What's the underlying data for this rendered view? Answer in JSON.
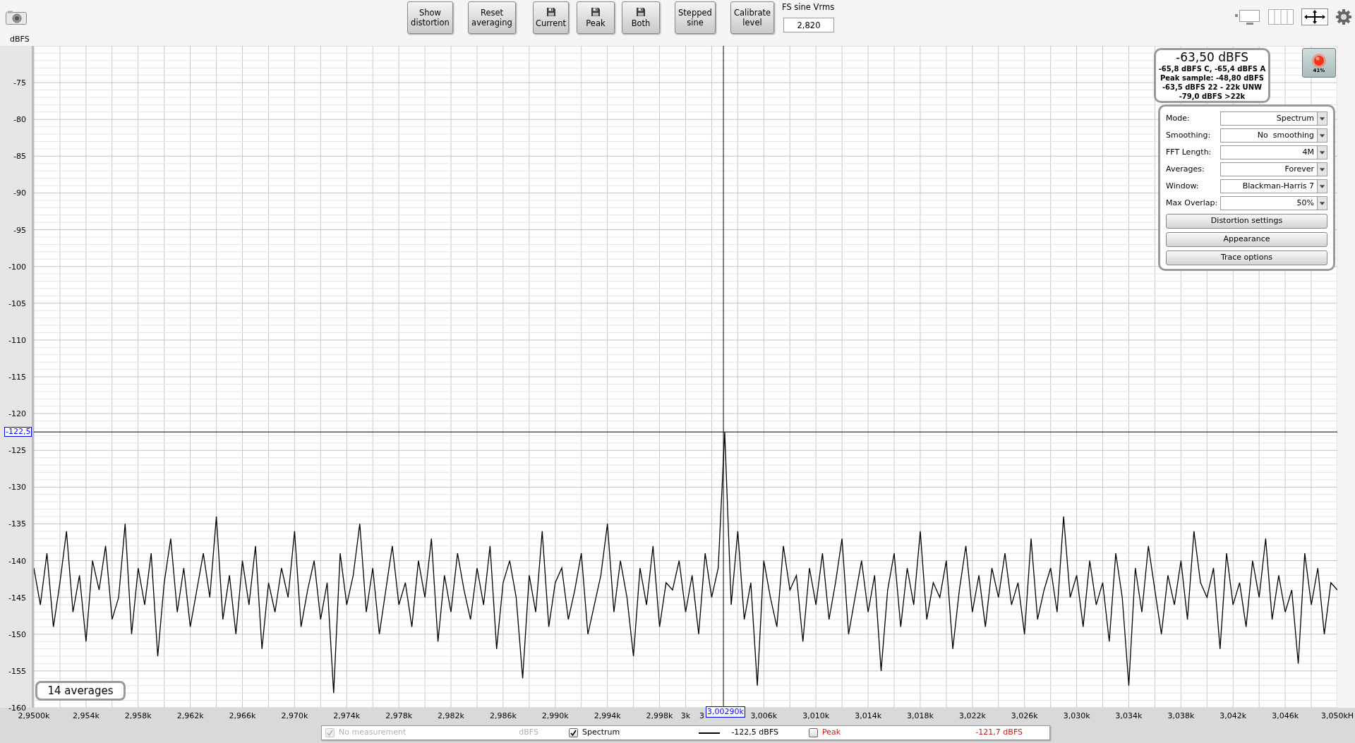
{
  "toolbar": {
    "buttons": [
      {
        "label": "Show\ndistortion",
        "kind": "text"
      },
      {
        "label": "Reset\naveraging",
        "kind": "text"
      },
      {
        "label": "Current",
        "kind": "save"
      },
      {
        "label": "Peak",
        "kind": "save"
      },
      {
        "label": "Both",
        "kind": "save"
      },
      {
        "label": "Stepped\nsine",
        "kind": "text"
      },
      {
        "label": "Calibrate\nlevel",
        "kind": "text"
      }
    ],
    "fs_field": {
      "label": "FS sine Vrms",
      "value": "2,820"
    }
  },
  "plot": {
    "chart_data": {
      "type": "line",
      "ylabel": "dBFS",
      "xlim": [
        2950,
        3050
      ],
      "ylim": [
        -160,
        -70
      ],
      "yticks": [
        {
          "value": -75,
          "label": "-75"
        },
        {
          "value": -80,
          "label": "-80"
        },
        {
          "value": -85,
          "label": "-85"
        },
        {
          "value": -90,
          "label": "-90"
        },
        {
          "value": -95,
          "label": "-95"
        },
        {
          "value": -100,
          "label": "-100"
        },
        {
          "value": -105,
          "label": "-105"
        },
        {
          "value": -110,
          "label": "-110"
        },
        {
          "value": -115,
          "label": "-115"
        },
        {
          "value": -120,
          "label": "-120"
        },
        {
          "value": -125,
          "label": "-125"
        },
        {
          "value": -130,
          "label": "-130"
        },
        {
          "value": -135,
          "label": "-135"
        },
        {
          "value": -140,
          "label": "-140"
        },
        {
          "value": -145,
          "label": "-145"
        },
        {
          "value": -150,
          "label": "-150"
        },
        {
          "value": -155,
          "label": "-155"
        },
        {
          "value": -160,
          "label": "-160"
        }
      ],
      "xticks": [
        {
          "value": 2950,
          "label": "2,9500k"
        },
        {
          "value": 2954,
          "label": "2,954k"
        },
        {
          "value": 2958,
          "label": "2,958k"
        },
        {
          "value": 2962,
          "label": "2,962k"
        },
        {
          "value": 2966,
          "label": "2,966k"
        },
        {
          "value": 2970,
          "label": "2,970k"
        },
        {
          "value": 2974,
          "label": "2,974k"
        },
        {
          "value": 2978,
          "label": "2,978k"
        },
        {
          "value": 2982,
          "label": "2,982k"
        },
        {
          "value": 2986,
          "label": "2,986k"
        },
        {
          "value": 2990,
          "label": "2,990k"
        },
        {
          "value": 2994,
          "label": "2,994k"
        },
        {
          "value": 2998,
          "label": "2,998k"
        },
        {
          "value": 3000,
          "label": "3k"
        },
        {
          "value": 3006,
          "label": "3,006k"
        },
        {
          "value": 3010,
          "label": "3,010k"
        },
        {
          "value": 3014,
          "label": "3,014k"
        },
        {
          "value": 3018,
          "label": "3,018k"
        },
        {
          "value": 3022,
          "label": "3,022k"
        },
        {
          "value": 3026,
          "label": "3,026k"
        },
        {
          "value": 3030,
          "label": "3,030k"
        },
        {
          "value": 3034,
          "label": "3,034k"
        },
        {
          "value": 3038,
          "label": "3,038k"
        },
        {
          "value": 3042,
          "label": "3,042k"
        },
        {
          "value": 3046,
          "label": "3,046k"
        },
        {
          "value": 3050,
          "label": "3,050kH"
        }
      ],
      "x": [
        2950,
        2950.5,
        2951,
        2951.5,
        2952,
        2952.5,
        2953,
        2953.5,
        2954,
        2954.5,
        2955,
        2955.5,
        2956,
        2956.5,
        2957,
        2957.5,
        2958,
        2958.5,
        2959,
        2959.5,
        2960,
        2960.5,
        2961,
        2961.5,
        2962,
        2962.5,
        2963,
        2963.5,
        2964,
        2964.5,
        2965,
        2965.5,
        2966,
        2966.5,
        2967,
        2967.5,
        2968,
        2968.5,
        2969,
        2969.5,
        2970,
        2970.5,
        2971,
        2971.5,
        2972,
        2972.5,
        2973,
        2973.5,
        2974,
        2974.5,
        2975,
        2975.5,
        2976,
        2976.5,
        2977,
        2977.5,
        2978,
        2978.5,
        2979,
        2979.5,
        2980,
        2980.5,
        2981,
        2981.5,
        2982,
        2982.5,
        2983,
        2983.5,
        2984,
        2984.5,
        2985,
        2985.5,
        2986,
        2986.5,
        2987,
        2987.5,
        2988,
        2988.5,
        2989,
        2989.5,
        2990,
        2990.5,
        2991,
        2991.5,
        2992,
        2992.5,
        2993,
        2993.5,
        2994,
        2994.5,
        2995,
        2995.5,
        2996,
        2996.5,
        2997,
        2997.5,
        2998,
        2998.5,
        2999,
        2999.5,
        3000,
        3000.5,
        3001,
        3001.5,
        3002,
        3002.5,
        3003,
        3003.5,
        3004,
        3004.5,
        3005,
        3005.5,
        3006,
        3006.5,
        3007,
        3007.5,
        3008,
        3008.5,
        3009,
        3009.5,
        3010,
        3010.5,
        3011,
        3011.5,
        3012,
        3012.5,
        3013,
        3013.5,
        3014,
        3014.5,
        3015,
        3015.5,
        3016,
        3016.5,
        3017,
        3017.5,
        3018,
        3018.5,
        3019,
        3019.5,
        3020,
        3020.5,
        3021,
        3021.5,
        3022,
        3022.5,
        3023,
        3023.5,
        3024,
        3024.5,
        3025,
        3025.5,
        3026,
        3026.5,
        3027,
        3027.5,
        3028,
        3028.5,
        3029,
        3029.5,
        3030,
        3030.5,
        3031,
        3031.5,
        3032,
        3032.5,
        3033,
        3033.5,
        3034,
        3034.5,
        3035,
        3035.5,
        3036,
        3036.5,
        3037,
        3037.5,
        3038,
        3038.5,
        3039,
        3039.5,
        3040,
        3040.5,
        3041,
        3041.5,
        3042,
        3042.5,
        3043,
        3043.5,
        3044,
        3044.5,
        3045,
        3045.5,
        3046,
        3046.5,
        3047,
        3047.5,
        3048,
        3048.5,
        3049,
        3049.5,
        3050
      ],
      "series": [
        {
          "name": "Spectrum",
          "color": "#000000",
          "values": [
            -141,
            -146,
            -139,
            -149,
            -143,
            -136,
            -147,
            -142,
            -151,
            -140,
            -144,
            -138,
            -148,
            -145,
            -135,
            -150,
            -141,
            -146,
            -139,
            -153,
            -143,
            -137,
            -147,
            -141,
            -149,
            -144,
            -139,
            -145,
            -134,
            -148,
            -142,
            -150,
            -140,
            -146,
            -138,
            -152,
            -143,
            -147,
            -141,
            -145,
            -136,
            -149,
            -144,
            -140,
            -148,
            -143,
            -158,
            -139,
            -146,
            -142,
            -135,
            -147,
            -141,
            -150,
            -144,
            -138,
            -146,
            -143,
            -149,
            -140,
            -145,
            -137,
            -151,
            -142,
            -147,
            -139,
            -144,
            -148,
            -141,
            -146,
            -138,
            -152,
            -143,
            -140,
            -145,
            -156,
            -142,
            -147,
            -136,
            -149,
            -143,
            -141,
            -148,
            -144,
            -139,
            -150,
            -146,
            -142,
            -135,
            -147,
            -140,
            -145,
            -153,
            -141,
            -146,
            -138,
            -149,
            -143,
            -144,
            -140,
            -147,
            -142,
            -150,
            -139,
            -145,
            -141,
            -122.5,
            -146,
            -136,
            -148,
            -143,
            -157,
            -140,
            -145,
            -149,
            -138,
            -144,
            -142,
            -151,
            -141,
            -146,
            -139,
            -148,
            -143,
            -137,
            -150,
            -145,
            -140,
            -147,
            -142,
            -155,
            -144,
            -139,
            -149,
            -141,
            -146,
            -136,
            -148,
            -143,
            -145,
            -140,
            -152,
            -144,
            -138,
            -147,
            -142,
            -149,
            -141,
            -145,
            -139,
            -146,
            -143,
            -150,
            -137,
            -148,
            -144,
            -141,
            -147,
            -134,
            -145,
            -142,
            -149,
            -140,
            -146,
            -143,
            -151,
            -139,
            -145,
            -157,
            -141,
            -147,
            -138,
            -144,
            -150,
            -142,
            -146,
            -140,
            -148,
            -136,
            -143,
            -145,
            -141,
            -152,
            -139,
            -146,
            -143,
            -149,
            -140,
            -145,
            -137,
            -148,
            -142,
            -147,
            -144,
            -154,
            -139,
            -146,
            -141,
            -150,
            -143,
            -144
          ]
        }
      ],
      "grid": true,
      "ref_lines": [
        {
          "axis": "x",
          "value": 3002.9,
          "label": "3,00290k"
        },
        {
          "axis": "y",
          "value": -122.5,
          "label": "-122,5"
        }
      ]
    },
    "readout": {
      "main": "-63,50 dBFS",
      "lines": [
        "-65,8 dBFS C, -65,4 dBFS A",
        "Peak sample: -48,80 dBFS",
        "-63,5 dBFS 22 - 22k UNW",
        "-79,0 dBFS >22k"
      ]
    },
    "level_indicator": {
      "label": "41%"
    },
    "settings": [
      {
        "label": "Mode:",
        "value": "Spectrum"
      },
      {
        "label": "Smoothing:",
        "value": "No  smoothing"
      },
      {
        "label": "FFT Length:",
        "value": "4M"
      },
      {
        "label": "Averages:",
        "value": "Forever"
      },
      {
        "label": "Window:",
        "value": "Blackman-Harris 7"
      },
      {
        "label": "Max Overlap:",
        "value": "50%"
      }
    ],
    "settings_buttons": [
      "Distortion settings",
      "Appearance",
      "Trace options"
    ],
    "averages": "14 averages",
    "covered_tick_label": "3"
  },
  "legend": [
    {
      "label": "No measurement",
      "checked": true,
      "disabled": true,
      "kind": "unit",
      "reading": "dBFS"
    },
    {
      "checked": true,
      "disabled": false,
      "kind": "trace",
      "reading": "-122,5 dBFS",
      "color": "#000000"
    },
    {
      "label": "Peak",
      "checked": false,
      "disabled": false,
      "kind": "plain",
      "reading": "-121,7 dBFS",
      "color": "#cc1a1a"
    }
  ]
}
